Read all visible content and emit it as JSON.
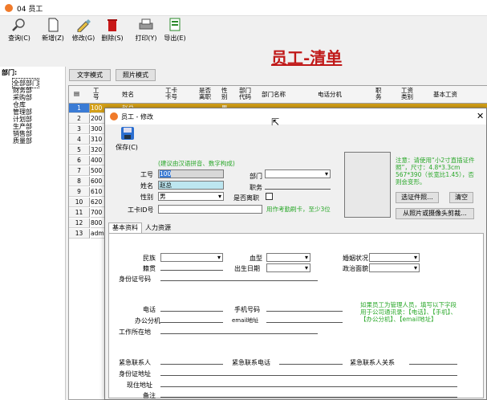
{
  "window": {
    "title": "04 员工"
  },
  "toolbar": [
    {
      "label": "查询(C)",
      "icon": "search-icon"
    },
    {
      "label": "新增(Z)",
      "icon": "new-document-icon"
    },
    {
      "label": "修改(G)",
      "icon": "edit-icon"
    },
    {
      "label": "删除(S)",
      "icon": "trash-icon"
    },
    {
      "label": "打印(Y)",
      "icon": "printer-icon"
    },
    {
      "label": "导出(E)",
      "icon": "excel-export-icon"
    }
  ],
  "page_title": "员工-清单",
  "view_modes": {
    "text": "文字模式",
    "photo": "照片模式"
  },
  "tree": {
    "header": "部门:",
    "items": [
      "全部部门",
      "财务部",
      "采购部",
      "仓库",
      "管理部",
      "计划部",
      "生产部",
      "销售部",
      "质量部"
    ]
  },
  "grid": {
    "headers": [
      "工号",
      "姓名",
      "卡号",
      "是否离职",
      "性别",
      "部门代码",
      "部门名称",
      "电话分机",
      "职务",
      "工资类别",
      "基本工资"
    ],
    "headers_display": [
      "工\n号",
      "姓名",
      "工卡\n卡号",
      "是否\n离职",
      "性\n别",
      "部门\n代码",
      "部门名称",
      "电话分机",
      "职\n务",
      "工资\n类别",
      "基本工资"
    ],
    "rows": [
      {
        "n": "1",
        "id": "100",
        "name": "赵总",
        "sex": "男"
      },
      {
        "n": "2",
        "id": "200"
      },
      {
        "n": "3",
        "id": "300"
      },
      {
        "n": "4",
        "id": "310"
      },
      {
        "n": "5",
        "id": "320"
      },
      {
        "n": "6",
        "id": "400"
      },
      {
        "n": "7",
        "id": "500"
      },
      {
        "n": "8",
        "id": "600"
      },
      {
        "n": "9",
        "id": "610"
      },
      {
        "n": "10",
        "id": "620"
      },
      {
        "n": "11",
        "id": "700"
      },
      {
        "n": "12",
        "id": "800"
      },
      {
        "n": "13",
        "id": "admin"
      }
    ],
    "selected_color": "#d4a017"
  },
  "dialog": {
    "title": "员工 - 修改",
    "save_label": "保存(C)",
    "hint": "(建议由汉语拼音、数字构成)",
    "fields": {
      "emp_no_label": "工号",
      "emp_no": "100",
      "name_label": "姓名",
      "name": "赵总",
      "sex_label": "性别",
      "sex": "男",
      "card_label": "工卡ID号",
      "dept_label": "部门",
      "title_label": "职务",
      "resigned_label": "是否离职"
    },
    "card_hint": "用作考勤刷卡，至少3位",
    "photo_note": "注意：请使用“小2寸直插证件照”，尺寸：4.8*3.3cm 567*390（长宽比1.45），否则会变形。",
    "photo_buttons": {
      "select": "选证件照...",
      "clear": "清空",
      "camera": "从照片或摄像头剪裁..."
    },
    "tabs": [
      "基本资料",
      "人力资源"
    ],
    "basic": {
      "ethnic": "民族",
      "blood": "血型",
      "marital": "婚姻状况",
      "native": "籍贯",
      "birthday": "出生日期",
      "politics": "政治面貌",
      "id_no": "身份证号码",
      "phone": "电话",
      "mobile": "手机号码",
      "office": "办公分机",
      "email": "email地址",
      "work_place": "工作所在地",
      "admin_note": "如果员工为管理人员，填写以下字段用于公司通讯录：【电话】、【手机】、【办公分机】、【email地址】",
      "emergency": "紧急联系人",
      "emergency_phone": "紧急联系电话",
      "emergency_rel": "紧急联系人关系",
      "id_address": "身份证地址",
      "home_address": "现住地址",
      "remark": "备注"
    }
  }
}
